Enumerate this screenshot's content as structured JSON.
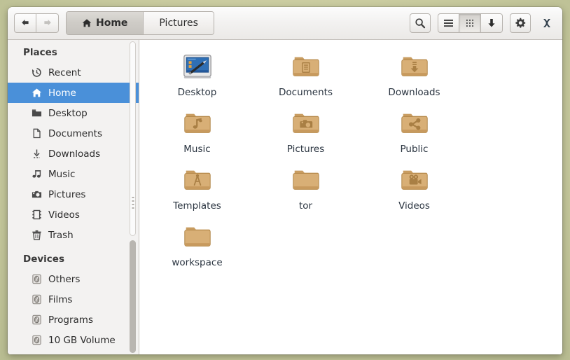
{
  "window": {
    "title": "Home",
    "close_label": "✖"
  },
  "toolbar": {
    "back_label": "◀",
    "forward_label": "▶",
    "back_name": "back-button",
    "forward_name": "forward-button",
    "search_label": "search",
    "list_view_label": "list-view",
    "grid_view_label": "grid-view",
    "sort_label": "sort-descending",
    "settings_label": "settings",
    "active_view": "grid"
  },
  "tabs": [
    {
      "label": "Home",
      "icon": "home-icon",
      "active": true
    },
    {
      "label": "Pictures",
      "icon": "",
      "active": false
    }
  ],
  "sidebar": {
    "sections": [
      {
        "title": "Places",
        "items": [
          {
            "label": "Recent",
            "icon": "recent-icon",
            "selected": false
          },
          {
            "label": "Home",
            "icon": "home-icon",
            "selected": true
          },
          {
            "label": "Desktop",
            "icon": "desktop-folder-icon",
            "selected": false
          },
          {
            "label": "Documents",
            "icon": "document-icon",
            "selected": false
          },
          {
            "label": "Downloads",
            "icon": "download-icon",
            "selected": false
          },
          {
            "label": "Music",
            "icon": "music-icon",
            "selected": false
          },
          {
            "label": "Pictures",
            "icon": "camera-icon",
            "selected": false
          },
          {
            "label": "Videos",
            "icon": "film-icon",
            "selected": false
          },
          {
            "label": "Trash",
            "icon": "trash-icon",
            "selected": false
          }
        ]
      },
      {
        "title": "Devices",
        "items": [
          {
            "label": "Others",
            "icon": "drive-icon",
            "selected": false
          },
          {
            "label": "Films",
            "icon": "drive-icon",
            "selected": false
          },
          {
            "label": "Programs",
            "icon": "drive-icon",
            "selected": false
          },
          {
            "label": "10 GB Volume",
            "icon": "drive-icon",
            "selected": false
          }
        ]
      }
    ]
  },
  "files": [
    {
      "label": "Desktop",
      "icon": "desktop-screen-icon"
    },
    {
      "label": "Documents",
      "icon": "folder-documents-icon"
    },
    {
      "label": "Downloads",
      "icon": "folder-downloads-icon"
    },
    {
      "label": "Music",
      "icon": "folder-music-icon"
    },
    {
      "label": "Pictures",
      "icon": "folder-pictures-icon"
    },
    {
      "label": "Public",
      "icon": "folder-public-icon"
    },
    {
      "label": "Templates",
      "icon": "folder-templates-icon"
    },
    {
      "label": "tor",
      "icon": "folder-plain-icon"
    },
    {
      "label": "Videos",
      "icon": "folder-videos-icon"
    },
    {
      "label": "workspace",
      "icon": "folder-plain-icon"
    }
  ],
  "colors": {
    "selection": "#4a90d9",
    "folder": "#d2a96f",
    "folder_dark": "#bb9057",
    "desktop_background": "#cbcda0",
    "window_chrome": "#f2f1f0",
    "sidebar_bg": "#f3f2f1",
    "label_text": "#2a3440"
  }
}
